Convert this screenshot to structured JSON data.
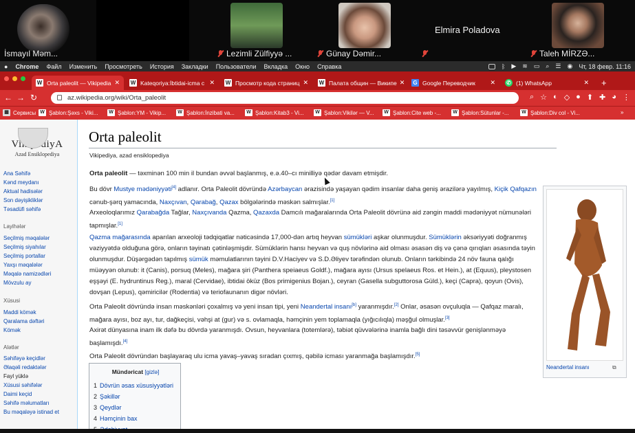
{
  "participants": [
    {
      "name": "İsmayıl Məm...",
      "muted": false
    },
    {
      "name": "",
      "muted": false
    },
    {
      "name": "Lezimli Zülfiyyə ...",
      "muted": true
    },
    {
      "name": "Günay Dəmir...",
      "muted": true
    },
    {
      "name": "Elmira Poladova",
      "muted": true
    },
    {
      "name": "Taleh MİRZƏ...",
      "muted": true
    }
  ],
  "macmenu": {
    "app": "Chrome",
    "items": [
      "Файл",
      "Изменить",
      "Просмотреть",
      "История",
      "Закладки",
      "Пользователи",
      "Вкладка",
      "Окно",
      "Справка"
    ],
    "clock": "Чт, 18 февр.  11:16"
  },
  "tabs": [
    {
      "label": "Orta paleolit — Vikipedia",
      "icon": "W",
      "active": true
    },
    {
      "label": "Kateqoriya:İbtidai-icma c",
      "icon": "W"
    },
    {
      "label": "Просмотр кода страниц",
      "icon": "W"
    },
    {
      "label": "Палата общин — Википе",
      "icon": "W"
    },
    {
      "label": "Google Переводчик",
      "icon": "G"
    },
    {
      "label": "(1) WhatsApp",
      "icon": "wa"
    }
  ],
  "url": "az.wikipedia.org/wiki/Orta_paleolit",
  "bookmarks": [
    "Сервисы",
    "Şablon:Şəxs - Viki...",
    "Şablon:YM - Vikip...",
    "Şablon:İnzibati va...",
    "Şablon:Kitab3 - Vi...",
    "Şablon:Viki​lər — V...",
    "Şablon:Cite web -...",
    "Şablon:Sütunlar -...",
    "Şablon:Div col - Vi..."
  ],
  "sidebar": {
    "logo_title": "VikipediyA",
    "logo_sub": "Azad Ensiklopediya",
    "nav": [
      "Ana Səhifə",
      "Kənd meydanı",
      "Aktual hadisələr",
      "Son dəyişikliklər",
      "Təsadüfi səhifə"
    ],
    "section1": "Layihələr",
    "projects": [
      "Seçilmiş məqalələr",
      "Seçilmiş siyahılar",
      "Seçilmiş portallar",
      "Yaxşı məqalələr",
      "Məqalə namizədləri",
      "Mövzulu ay"
    ],
    "section2": "Xüsusi",
    "special": [
      "Maddi kömək",
      "Qaralama dəftəri",
      "Kömək"
    ],
    "section3": "Alətlər",
    "tools": [
      "Səhifəyə keçidlər",
      "Əlaqəli redaktələr",
      "Fayl yüklə",
      "Xüsusi səhifələr",
      "Daimi keçid",
      "Səhifə məlumatları",
      "Bu məqaləyə istinad et"
    ]
  },
  "article": {
    "title": "Orta paleolit",
    "subtitle": "Vikipediya, azad ensiklopediya",
    "p1_bold": "Orta paleolit",
    "p1_rest": " — təxminən 100 min il bundan əvvəl başlanmış, e.ə.40–cı minilliyə qədər davam etmişdir.",
    "p2a": "Bu dövr ",
    "p2_l1": "Mustye mədəniyyəti",
    "p2_s1": "[4]",
    "p2b": " adlanır. Orta Paleolit dövründə ",
    "p2_l2": "Azərbaycan",
    "p2c": " ərazisində yaşayan qədim insanlar daha geniş ərazilərə yayılmış, ",
    "p2_l3": "Kiçik Qafqazın",
    "p2d": " cənub-şərq yamacında, ",
    "p2_l4": "Naxçıvan",
    "p2e": ", ",
    "p2_l5": "Qarabağ",
    "p2f": ", ",
    "p2_l6": "Qazax",
    "p2g": " bölgələrində məskən salmışlar.",
    "p2_s2": "[1]",
    "p3_l1": "Arxeoloqlarımız ",
    "p3_a1": "Qarabağda",
    "p3b": " Tağlar, ",
    "p3_a2": "Naxçıvanda",
    "p3c": " Qazma, ",
    "p3_a3": "Qazaxda",
    "p3d": " Damcılı mağaralarında Orta Paleolit dövrünə aid zəngin maddi mədəniyyət nümunələri tapmışlar.",
    "p3_s1": "[1]",
    "p4_a1": "Qazma mağarasında",
    "p4a": " aparılan arxeoloji tədqiqatlar nəticəsində 17,000-dən artıq heyvan ",
    "p4_a2": "sümükləri",
    "p4b": " aşkar olunmuşdur. ",
    "p4_a3": "Sümüklərin",
    "p4c": " əksəriyyəti doğranmış vəziyyətdə olduğuna görə, onların təyinatı çətinləşmişdir. Sümüklərin hansı heyvan və quş növlərinə aid olması əsasən diş və çənə qırıqları əsasında təyin olunmuşdur. Düşərgədən tapılmış ",
    "p4_a4": "sümük",
    "p4d": " məmulatlarının təyini D.V.Haciyev və S.D.Əliyev tərəfindən olunub. Onların tərkibində 24 növ fauna qalığı müəyyən olunub: it (Canis), porsuq (Meles), mağara şiri (Panthera speiaeus Goldf.), mağara ayısı (Ursus spelaeus Ros. et Hein.), at (Equus), pleystosen eşşəyi (E. hydruntinus Reg.), maral (Cervidae), ibtidai öküz (Bos primigenius Bojan.), ceyran (Gasella subguttorosa Güld.), keçi (Capra), qoyun (Ovis), dovşan (Lepus), qəmiricilər (Rodentia) və teriofaunanın digər növləri.",
    "p5a": "Orta Paleolit dövründə insan məskənləri çoxalmış və yeni insan tipi, yeni ",
    "p5_a1": "Neandertal insanı",
    "p5_s1": "[b]",
    "p5b": " yaranmışdır.",
    "p5_s2": "[2]",
    "p5c": " Onlar, əsasən ovçuluqla — Qafqaz maralı, mağara ayısı, boz ayı, tur, dağkeçisi, vəhşi at (gur) və s. ovlamaqla, həmçinin yem toplamaqla (yığıcılıqla) məşğul olmuşlar.",
    "p5_s3": "[3]",
    "p6a": "Axirət dünyasına inam ilk dəfə bu dövrdə yaranmışdı. Ovsun, heyvanlara (totemlərə), təbiət qüvvələrinə inamla bağlı dini təsəvvür genişlənməyə başlamışdı.",
    "p6_s1": "[4]",
    "p7a": "Orta Paleolit dövründən başlayaraq ulu icma yavaş–yavaş sıradan çıxmış, qəbilə icması yaranmağa başlamışdır.",
    "p7_s1": "[5]",
    "image_caption": "Neandertal insanı"
  },
  "toc": {
    "title": "Mündəricat",
    "toggle": "[gizlə]",
    "items": [
      {
        "n": "1",
        "t": "Dövrün əsas xüsusiyyətləri"
      },
      {
        "n": "2",
        "t": "Şəkillər"
      },
      {
        "n": "3",
        "t": "Qeydlər"
      },
      {
        "n": "4",
        "t": "Həmçinin bax"
      },
      {
        "n": "5",
        "t": "Ədəbiyyat"
      }
    ]
  }
}
